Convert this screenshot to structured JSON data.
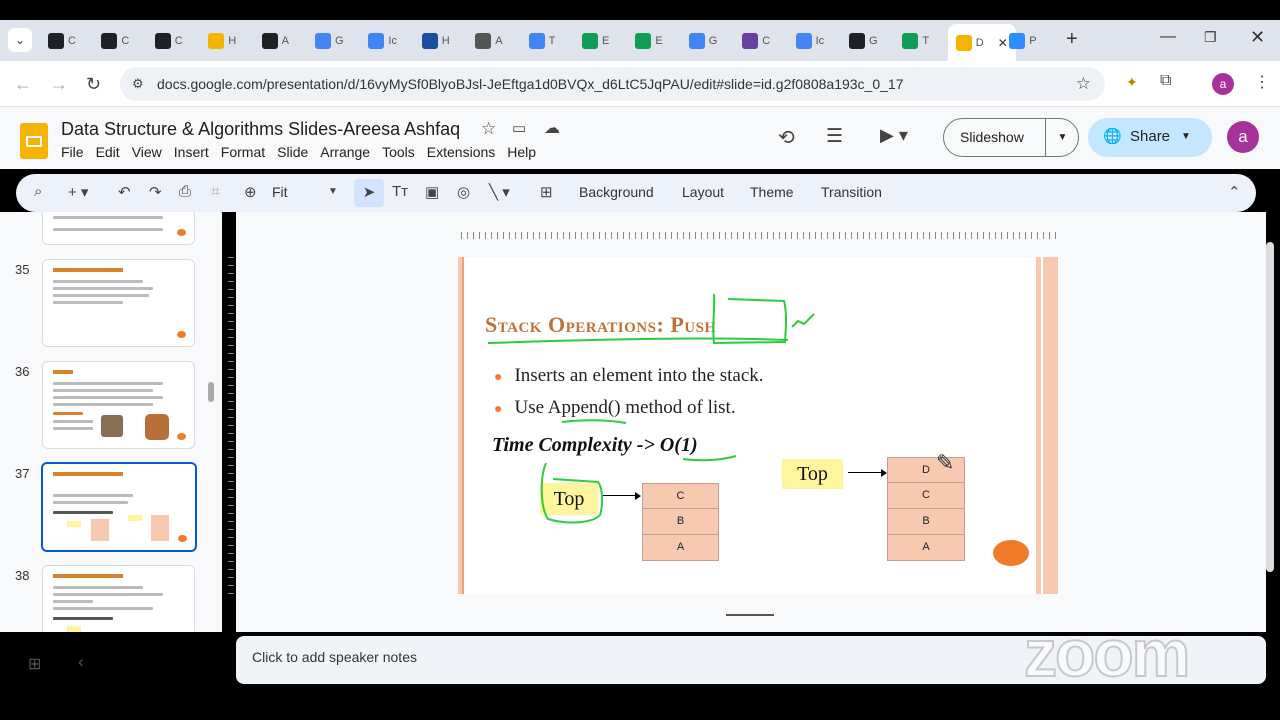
{
  "browser": {
    "tabs": [
      {
        "label": "C",
        "color": "#202124"
      },
      {
        "label": "C",
        "color": "#202124"
      },
      {
        "label": "C",
        "color": "#202124"
      },
      {
        "label": "H",
        "color": "#f4b400"
      },
      {
        "label": "A",
        "color": "#202124"
      },
      {
        "label": "G",
        "color": "#4285f4"
      },
      {
        "label": "Ic",
        "color": "#4285f4"
      },
      {
        "label": "H",
        "color": "#1a4fa0"
      },
      {
        "label": "A",
        "color": "#555"
      },
      {
        "label": "T",
        "color": "#4285f4"
      },
      {
        "label": "E",
        "color": "#0f9d58"
      },
      {
        "label": "E",
        "color": "#0f9d58"
      },
      {
        "label": "G",
        "color": "#4285f4"
      },
      {
        "label": "C",
        "color": "#6b3fa0"
      },
      {
        "label": "Ic",
        "color": "#4285f4"
      },
      {
        "label": "G",
        "color": "#202124"
      },
      {
        "label": "T",
        "color": "#0f9d58"
      },
      {
        "label": "D",
        "color": "#f4b400",
        "active": true
      },
      {
        "label": "P",
        "color": "#2d8cff"
      }
    ],
    "url": "docs.google.com/presentation/d/16vyMySf0BlyoBJsl-JeEftga1d0BVQx_d6LtC5JqPAU/edit#slide=id.g2f0808a193c_0_17",
    "profile_initial": "a"
  },
  "app": {
    "title": "Data Structure & Algorithms Slides-Areesa Ashfaq",
    "menu": [
      "File",
      "Edit",
      "View",
      "Insert",
      "Format",
      "Slide",
      "Arrange",
      "Tools",
      "Extensions",
      "Help"
    ],
    "slideshow_label": "Slideshow",
    "share_label": "Share",
    "avatar_initial": "a",
    "accent_color": "#0b57d0",
    "share_bg": "#c2e7ff"
  },
  "toolbar": {
    "zoom_label": "Fit",
    "text_buttons": [
      "Background",
      "Layout",
      "Theme",
      "Transition"
    ]
  },
  "filmstrip": {
    "slides": [
      {
        "num": "35",
        "title": "Week 3: Contents"
      },
      {
        "num": "36",
        "title": "Stack:"
      },
      {
        "num": "37",
        "title": "Stack Operations: Push",
        "selected": true
      },
      {
        "num": "38",
        "title": "Stack Operations: Pop"
      }
    ]
  },
  "slide": {
    "title_part1": "Stack Operations: ",
    "title_part2": "Push",
    "bullets": [
      "Inserts an element into the stack.",
      "Use Append() method of list."
    ],
    "time_complexity_prefix": "Time Complexity -> ",
    "time_complexity_value": "O(1)",
    "left_stack": {
      "top_label": "Top",
      "cells": [
        "C",
        "B",
        "A"
      ]
    },
    "right_stack": {
      "top_label": "Top",
      "cells": [
        "D",
        "C",
        "B",
        "A"
      ]
    },
    "title_color": "#c0703a",
    "bullet_color": "#f07c2a",
    "cell_color": "#f7c9b0",
    "top_box_color": "#fff59d",
    "annotation_color": "#2ecc40"
  },
  "notes": {
    "placeholder": "Click to add speaker notes"
  },
  "watermark": "zoom"
}
